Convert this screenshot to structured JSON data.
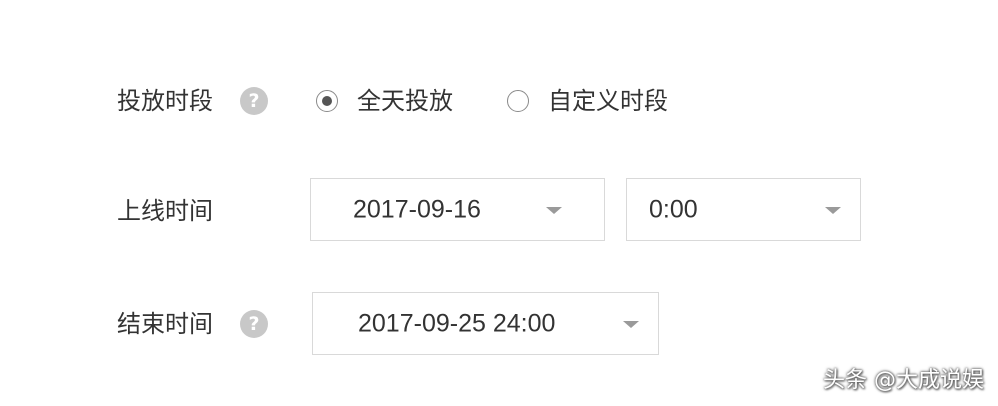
{
  "schedule": {
    "label": "投放时段",
    "help_symbol": "?",
    "options": [
      {
        "label": "全天投放",
        "selected": true
      },
      {
        "label": "自定义时段",
        "selected": false
      }
    ]
  },
  "start_time": {
    "label": "上线时间",
    "date_value": "2017-09-16",
    "time_value": "0:00"
  },
  "end_time": {
    "label": "结束时间",
    "help_symbol": "?",
    "datetime_value": "2017-09-25 24:00"
  },
  "watermark": {
    "text": "头条 @大成说娱"
  },
  "colors": {
    "text": "#333333",
    "border": "#d9d9d9",
    "help_icon_bg": "#c8c8c8",
    "caret": "#9a9a9a"
  }
}
